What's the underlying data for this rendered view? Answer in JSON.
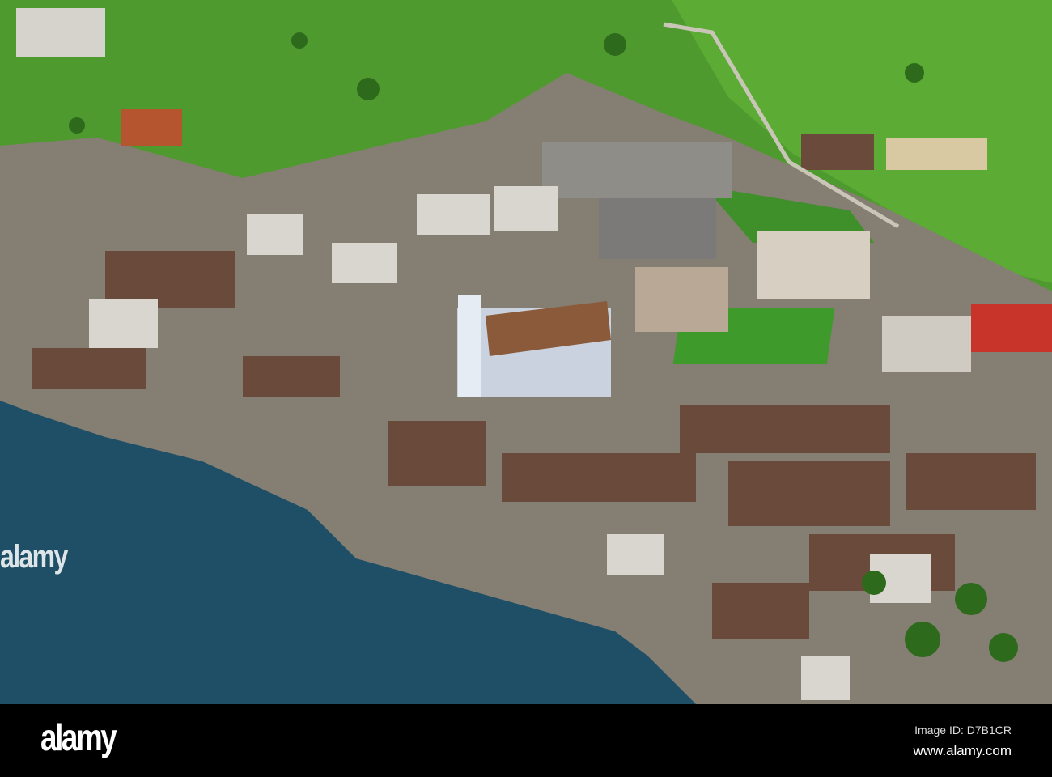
{
  "watermark": {
    "overlay_logo": "alamy"
  },
  "footer": {
    "logo": "alamy",
    "image_id": "Image ID: D7B1CR",
    "url": "www.alamy.com"
  },
  "colors": {
    "field": "#4f9a2e",
    "lake": "#1e4f66",
    "town": "#8a8478",
    "roof": "#6a4a3a"
  }
}
